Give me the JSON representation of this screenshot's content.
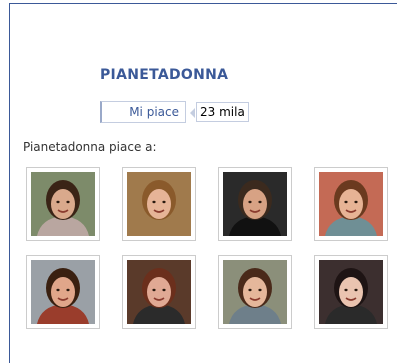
{
  "page": {
    "name": "PIANETADONNA",
    "like_label": "Mi piace",
    "like_count": "23 mila",
    "fans_label": "Pianetadonna piace a:"
  },
  "fans": [
    {
      "bg": "#7d8b6a",
      "skin": "#d9a98c",
      "hair": "#3a2416",
      "shirt": "#b9a6a0"
    },
    {
      "bg": "#a07a4c",
      "skin": "#e6b497",
      "hair": "#8a5a2b",
      "shirt": "#a07a4c"
    },
    {
      "bg": "#2a2a2a",
      "skin": "#d7a284",
      "hair": "#3b2a1e",
      "shirt": "#111111"
    },
    {
      "bg": "#c46a55",
      "skin": "#e7b395",
      "hair": "#6b3a1f",
      "shirt": "#6f8f95"
    },
    {
      "bg": "#9aa0a6",
      "skin": "#e0a68a",
      "hair": "#3a2010",
      "shirt": "#9a3d2c"
    },
    {
      "bg": "#5a3a2a",
      "skin": "#e0a994",
      "hair": "#6b2f1c",
      "shirt": "#2b2b2b"
    },
    {
      "bg": "#8b8f7a",
      "skin": "#e5b79b",
      "hair": "#4a2a1a",
      "shirt": "#6e7f8a"
    },
    {
      "bg": "#3c2f2f",
      "skin": "#eac4b0",
      "hair": "#1e1414",
      "shirt": "#2a2a2a"
    }
  ]
}
